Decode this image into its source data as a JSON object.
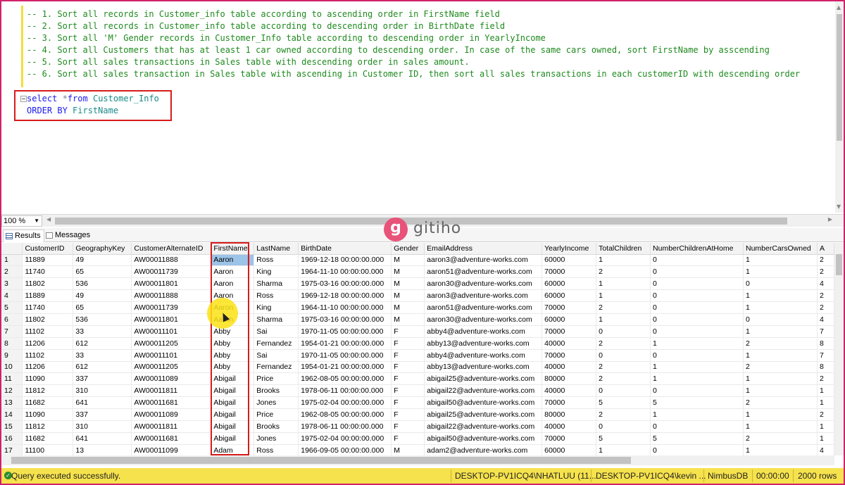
{
  "editor": {
    "comments": [
      "-- 1. Sort all records in Customer_info table according to ascending order in FirstName field",
      "-- 2. Sort all records in Customer_info table according to descending order in BirthDate field",
      "-- 3. Sort all 'M' Gender records in Customer_Info table according to descending order in YearlyIncome",
      "-- 4. Sort all Customers that has at least 1 car owned according to descending order. In case of the same cars owned, sort FirstName by asscending",
      "-- 5. Sort all sales transactions in Sales table with descending order in sales amount.",
      "-- 6. Sort all sales transaction in Sales table with ascending in Customer ID, then sort all sales transactions in each customerID with descending order"
    ],
    "query": {
      "kw_select": "select",
      "star": "*",
      "kw_from": "from",
      "table": "Customer_Info",
      "kw_order": "ORDER BY",
      "column": "FirstName"
    }
  },
  "zoom": {
    "value": "100 %"
  },
  "tabs": {
    "results": "Results",
    "messages": "Messages"
  },
  "logo": {
    "mark": "g",
    "word": "gitiho"
  },
  "grid": {
    "columns": [
      "",
      "CustomerID",
      "GeographyKey",
      "CustomerAlternateID",
      "FirstName",
      "LastName",
      "BirthDate",
      "Gender",
      "EmailAddress",
      "YearlyIncome",
      "TotalChildren",
      "NumberChildrenAtHome",
      "NumberCarsOwned",
      "A"
    ],
    "rows": [
      [
        "1",
        "11889",
        "49",
        "AW00011888",
        "Aaron",
        "Ross",
        "1969-12-18 00:00:00.000",
        "M",
        "aaron3@adventure-works.com",
        "60000",
        "1",
        "0",
        "1",
        "2"
      ],
      [
        "2",
        "11740",
        "65",
        "AW00011739",
        "Aaron",
        "King",
        "1964-11-10 00:00:00.000",
        "M",
        "aaron51@adventure-works.com",
        "70000",
        "2",
        "0",
        "1",
        "2"
      ],
      [
        "3",
        "11802",
        "536",
        "AW00011801",
        "Aaron",
        "Sharma",
        "1975-03-16 00:00:00.000",
        "M",
        "aaron30@adventure-works.com",
        "60000",
        "1",
        "0",
        "0",
        "4"
      ],
      [
        "4",
        "11889",
        "49",
        "AW00011888",
        "Aaron",
        "Ross",
        "1969-12-18 00:00:00.000",
        "M",
        "aaron3@adventure-works.com",
        "60000",
        "1",
        "0",
        "1",
        "2"
      ],
      [
        "5",
        "11740",
        "65",
        "AW00011739",
        "Aaron",
        "King",
        "1964-11-10 00:00:00.000",
        "M",
        "aaron51@adventure-works.com",
        "70000",
        "2",
        "0",
        "1",
        "2"
      ],
      [
        "6",
        "11802",
        "536",
        "AW00011801",
        "Aaron",
        "Sharma",
        "1975-03-16 00:00:00.000",
        "M",
        "aaron30@adventure-works.com",
        "60000",
        "1",
        "0",
        "0",
        "4"
      ],
      [
        "7",
        "11102",
        "33",
        "AW00011101",
        "Abby",
        "Sai",
        "1970-11-05 00:00:00.000",
        "F",
        "abby4@adventure-works.com",
        "70000",
        "0",
        "0",
        "1",
        "7"
      ],
      [
        "8",
        "11206",
        "612",
        "AW00011205",
        "Abby",
        "Fernandez",
        "1954-01-21 00:00:00.000",
        "F",
        "abby13@adventure-works.com",
        "40000",
        "2",
        "1",
        "2",
        "8"
      ],
      [
        "9",
        "11102",
        "33",
        "AW00011101",
        "Abby",
        "Sai",
        "1970-11-05 00:00:00.000",
        "F",
        "abby4@adventure-works.com",
        "70000",
        "0",
        "0",
        "1",
        "7"
      ],
      [
        "10",
        "11206",
        "612",
        "AW00011205",
        "Abby",
        "Fernandez",
        "1954-01-21 00:00:00.000",
        "F",
        "abby13@adventure-works.com",
        "40000",
        "2",
        "1",
        "2",
        "8"
      ],
      [
        "11",
        "11090",
        "337",
        "AW00011089",
        "Abigail",
        "Price",
        "1962-08-05 00:00:00.000",
        "F",
        "abigail25@adventure-works.com",
        "80000",
        "2",
        "1",
        "1",
        "2"
      ],
      [
        "12",
        "11812",
        "310",
        "AW00011811",
        "Abigail",
        "Brooks",
        "1978-06-11 00:00:00.000",
        "F",
        "abigail22@adventure-works.com",
        "40000",
        "0",
        "0",
        "1",
        "1"
      ],
      [
        "13",
        "11682",
        "641",
        "AW00011681",
        "Abigail",
        "Jones",
        "1975-02-04 00:00:00.000",
        "F",
        "abigail50@adventure-works.com",
        "70000",
        "5",
        "5",
        "2",
        "1"
      ],
      [
        "14",
        "11090",
        "337",
        "AW00011089",
        "Abigail",
        "Price",
        "1962-08-05 00:00:00.000",
        "F",
        "abigail25@adventure-works.com",
        "80000",
        "2",
        "1",
        "1",
        "2"
      ],
      [
        "15",
        "11812",
        "310",
        "AW00011811",
        "Abigail",
        "Brooks",
        "1978-06-11 00:00:00.000",
        "F",
        "abigail22@adventure-works.com",
        "40000",
        "0",
        "0",
        "1",
        "1"
      ],
      [
        "16",
        "11682",
        "641",
        "AW00011681",
        "Abigail",
        "Jones",
        "1975-02-04 00:00:00.000",
        "F",
        "abigail50@adventure-works.com",
        "70000",
        "5",
        "5",
        "2",
        "1"
      ],
      [
        "17",
        "11100",
        "13",
        "AW00011099",
        "Adam",
        "Ross",
        "1966-09-05 00:00:00.000",
        "M",
        "adam2@adventure-works.com",
        "60000",
        "1",
        "0",
        "1",
        "4"
      ]
    ]
  },
  "status": {
    "icon": "check-icon",
    "message": "Query executed successfully.",
    "server": "DESKTOP-PV1ICQ4\\NHATLUU (11...",
    "user": "DESKTOP-PV1ICQ4\\kevin ...",
    "database": "NimbusDB",
    "elapsed": "00:00:00",
    "rows": "2000 rows"
  },
  "colors": {
    "frame": "#d0226a",
    "status_bar": "#f6e24d",
    "annotation": "#d81b1b",
    "brand": "#e8537a"
  }
}
